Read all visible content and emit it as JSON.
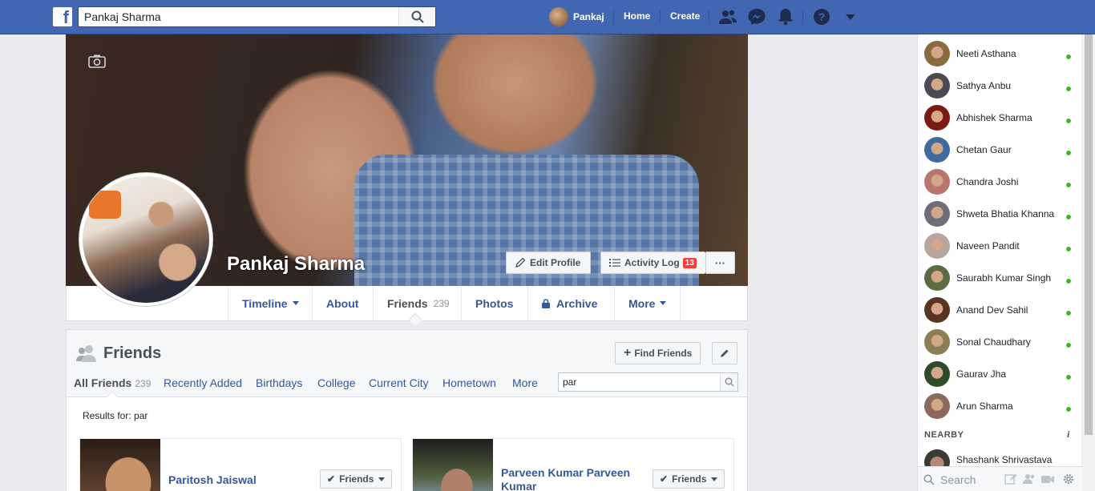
{
  "topbar": {
    "logo": "f",
    "search_value": "Pankaj Sharma",
    "user_name": "Pankaj",
    "home_label": "Home",
    "create_label": "Create",
    "icons": [
      "friend-requests-icon",
      "messenger-icon",
      "notifications-icon",
      "help-icon",
      "account-menu-icon"
    ]
  },
  "profile": {
    "name": "Pankaj Sharma",
    "edit_profile": "Edit Profile",
    "activity_log": "Activity Log",
    "activity_count": "13",
    "more_dots": "···"
  },
  "tabs": [
    {
      "label": "Timeline",
      "count": ""
    },
    {
      "label": "About",
      "count": ""
    },
    {
      "label": "Friends",
      "count": "239"
    },
    {
      "label": "Photos",
      "count": ""
    },
    {
      "label": "Archive",
      "count": ""
    },
    {
      "label": "More",
      "count": ""
    }
  ],
  "friends": {
    "title": "Friends",
    "find_friends": "Find Friends",
    "subtabs": [
      {
        "label": "All Friends",
        "count": "239"
      },
      {
        "label": "Recently Added"
      },
      {
        "label": "Birthdays"
      },
      {
        "label": "College"
      },
      {
        "label": "Current City"
      },
      {
        "label": "Hometown"
      },
      {
        "label": "More"
      }
    ],
    "search_value": "par",
    "results_label": "Results for: par",
    "cards": [
      {
        "name": "Paritosh Jaiswal",
        "button": "Friends"
      },
      {
        "name": "Parveen Kumar Parveen Kumar",
        "button": "Friends"
      }
    ]
  },
  "chat": {
    "contacts": [
      {
        "name": "Neeti Asthana",
        "color": "#8a6b3f"
      },
      {
        "name": "Sathya Anbu",
        "color": "#4a4a55"
      },
      {
        "name": "Abhishek Sharma",
        "color": "#7a1a12"
      },
      {
        "name": "Chetan Gaur",
        "color": "#3f6aa0"
      },
      {
        "name": "Chandra Joshi",
        "color": "#b7776f"
      },
      {
        "name": "Shweta Bhatia Khanna",
        "color": "#6e6e78"
      },
      {
        "name": "Naveen Pandit",
        "color": "#b9a5a0"
      },
      {
        "name": "Saurabh Kumar Singh",
        "color": "#5d6b44"
      },
      {
        "name": "Anand Dev Sahil",
        "color": "#5a3322"
      },
      {
        "name": "Sonal Chaudhary",
        "color": "#8c7d55"
      },
      {
        "name": "Gaurav Jha",
        "color": "#2f4b2a"
      },
      {
        "name": "Arun Sharma",
        "color": "#8a6a5a"
      }
    ],
    "nearby_label": "NEARBY",
    "nearby_info": "i",
    "nearby_contact": "Shashank Shrivastava",
    "search_placeholder": "Search"
  },
  "colors": {
    "brand": "#4267b2",
    "link": "#365899",
    "online": "#42b72a",
    "badge": "#fa3e3e"
  }
}
